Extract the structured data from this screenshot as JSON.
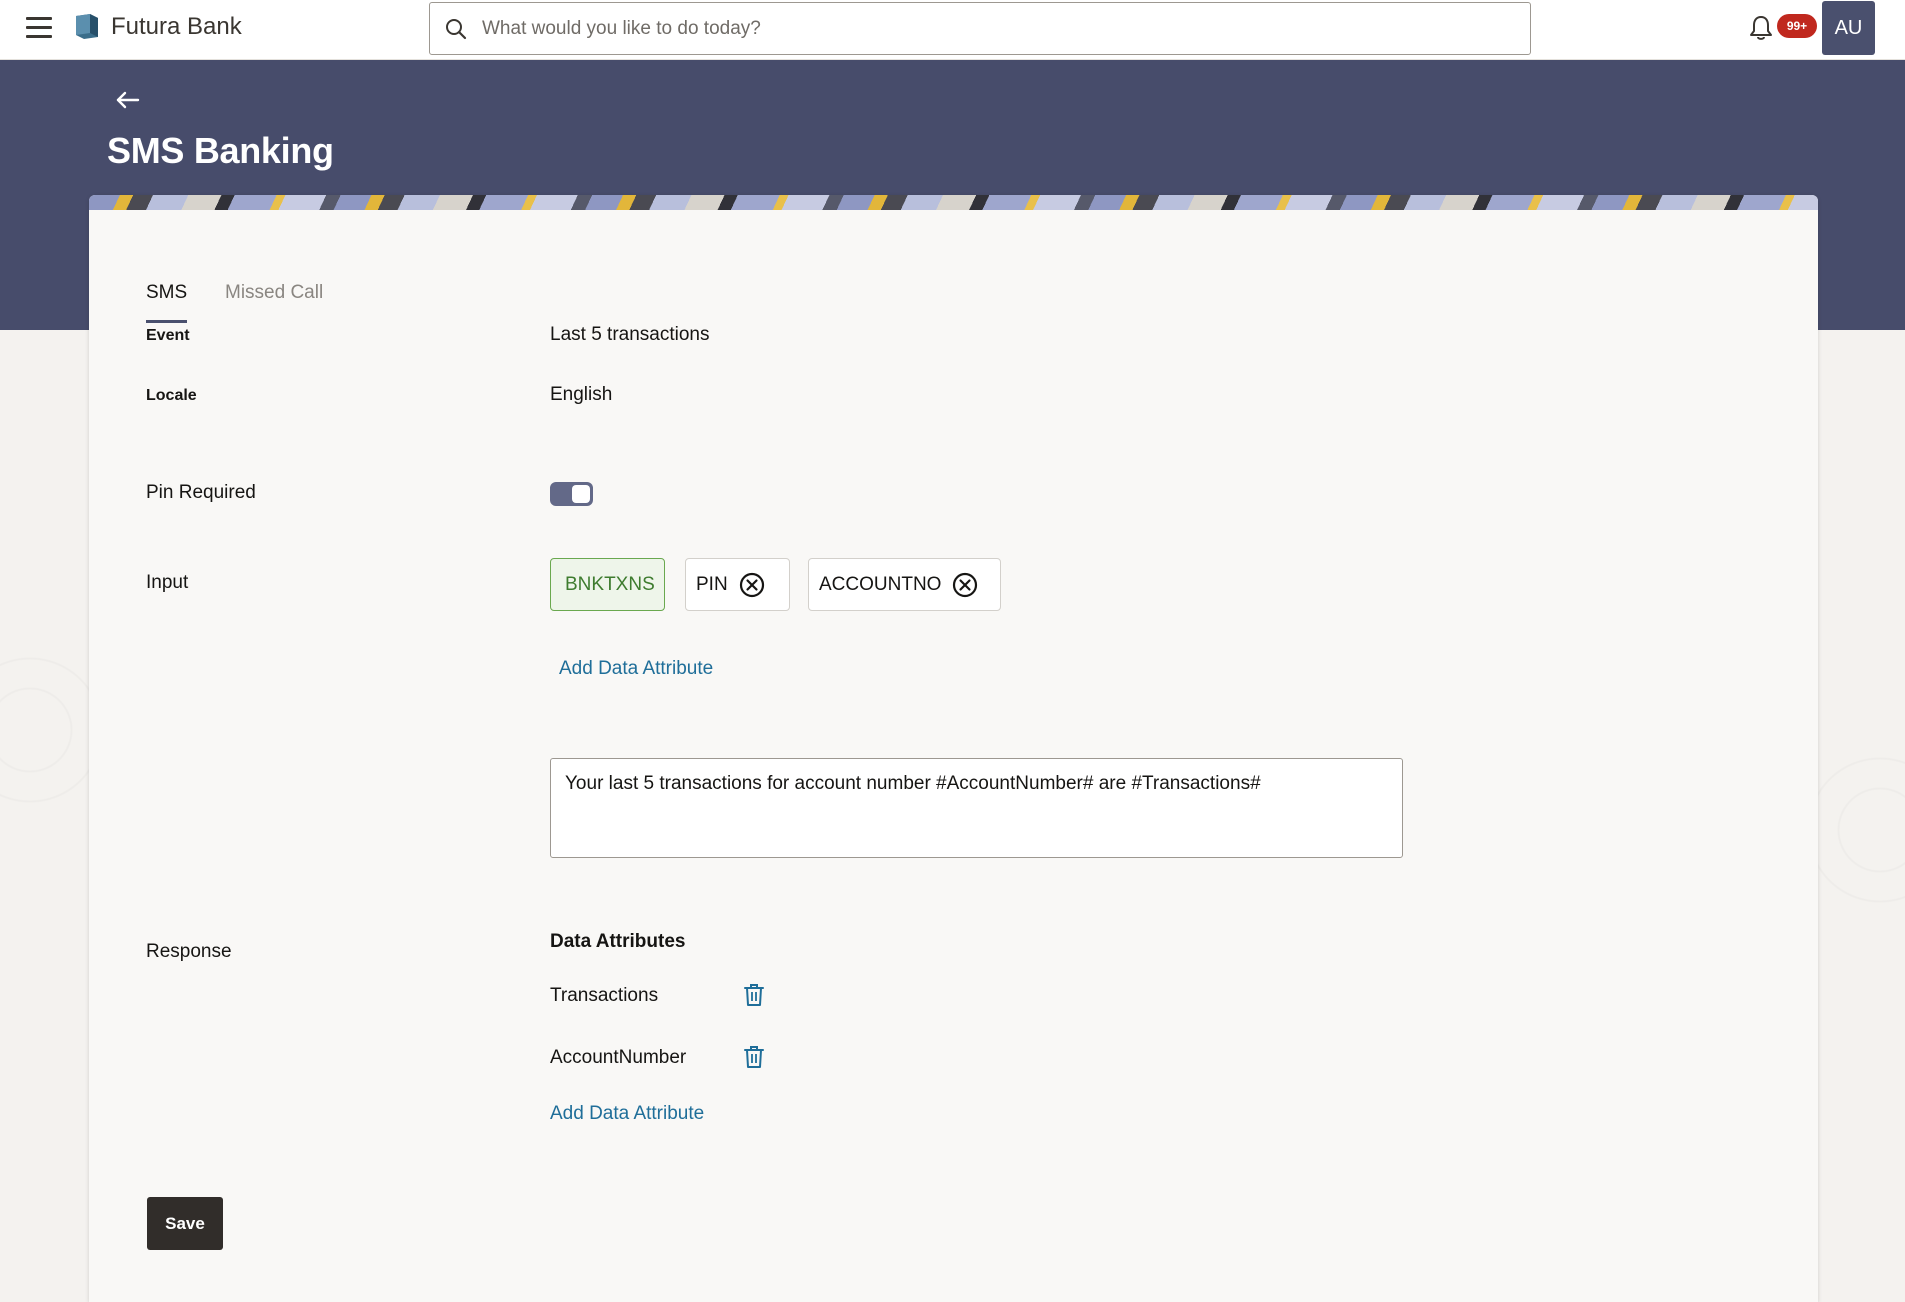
{
  "app": {
    "brand": "Futura Bank"
  },
  "search": {
    "placeholder": "What would you like to do today?",
    "value": ""
  },
  "notifications": {
    "badge": "99+"
  },
  "user": {
    "initials": "AU"
  },
  "page": {
    "title": "SMS Banking"
  },
  "tabs": [
    {
      "label": "SMS",
      "active": true
    },
    {
      "label": "Missed Call",
      "active": false
    }
  ],
  "form": {
    "event_label": "Event",
    "event_value": "Last 5 transactions",
    "locale_label": "Locale",
    "locale_value": "English",
    "pin_label": "Pin Required",
    "pin_required": true,
    "input_label": "Input",
    "input_chips": [
      "BNKTXNS",
      "PIN",
      "ACCOUNTNO"
    ],
    "add_input_attribute": "Add Data Attribute",
    "message_template": "Your last 5 transactions for account number #AccountNumber# are #Transactions#",
    "response_label": "Response",
    "data_attributes_heading": "Data Attributes",
    "data_attributes": [
      "Transactions",
      "AccountNumber"
    ],
    "add_response_attribute": "Add Data Attribute",
    "save_label": "Save"
  },
  "icons": {
    "menu": "hamburger-icon",
    "logo": "bank-logo-icon",
    "search": "search-icon",
    "bell": "bell-icon",
    "back": "back-arrow-icon",
    "remove": "close-circle-icon",
    "delete": "trash-icon"
  },
  "colors": {
    "header_band": "#474c6b",
    "link": "#1f6e99",
    "badge": "#c0281e",
    "active_chip": "#6aa84f",
    "save_button": "#312d2a"
  }
}
